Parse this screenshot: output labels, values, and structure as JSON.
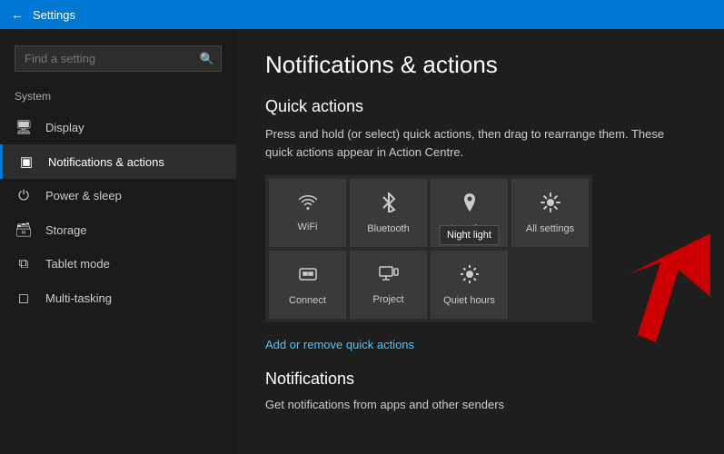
{
  "titleBar": {
    "title": "Settings",
    "backLabel": "←"
  },
  "sidebar": {
    "searchPlaceholder": "Find a setting",
    "sectionLabel": "System",
    "items": [
      {
        "id": "display",
        "label": "Display",
        "icon": "🖥"
      },
      {
        "id": "notifications",
        "label": "Notifications & actions",
        "icon": "🔲",
        "active": true
      },
      {
        "id": "power",
        "label": "Power & sleep",
        "icon": "⏻"
      },
      {
        "id": "storage",
        "label": "Storage",
        "icon": "🗄"
      },
      {
        "id": "tablet",
        "label": "Tablet mode",
        "icon": "⊞"
      },
      {
        "id": "multitasking",
        "label": "Multi-tasking",
        "icon": "⬜"
      }
    ]
  },
  "content": {
    "pageTitle": "Notifications & actions",
    "quickActions": {
      "sectionTitle": "Quick actions",
      "description": "Press and hold (or select) quick actions, then drag to rearrange them. These quick actions appear in Action Centre.",
      "tiles": [
        {
          "id": "wifi",
          "label": "WiFi",
          "icon": "wifi"
        },
        {
          "id": "bluetooth",
          "label": "Bluetooth",
          "icon": "bluetooth"
        },
        {
          "id": "location",
          "label": "Location",
          "icon": "location"
        },
        {
          "id": "allsettings",
          "label": "All settings",
          "icon": "gear"
        },
        {
          "id": "connect",
          "label": "Connect",
          "icon": "connect"
        },
        {
          "id": "project",
          "label": "Project",
          "icon": "project"
        },
        {
          "id": "nightlight",
          "label": "Quiet hours",
          "icon": "moon",
          "tooltip": "Night light"
        },
        {
          "id": "empty",
          "label": "",
          "icon": ""
        }
      ],
      "addRemoveLabel": "Add or remove quick actions"
    },
    "notifications": {
      "sectionTitle": "Notifications",
      "description": "Get notifications from apps and other senders"
    }
  }
}
